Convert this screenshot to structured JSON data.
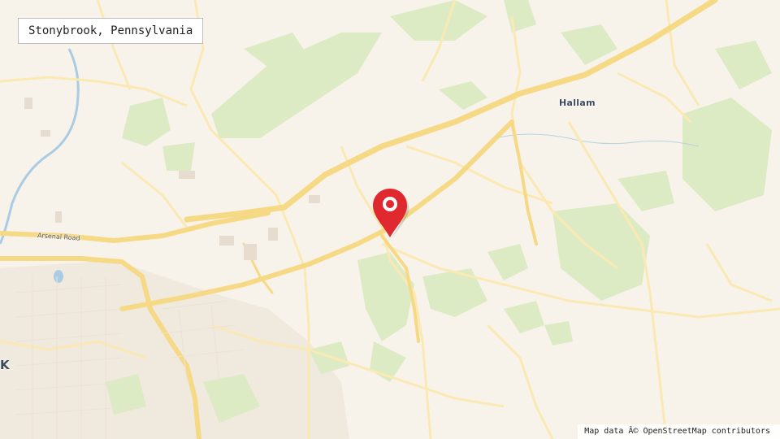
{
  "location": {
    "title": "Stonybrook, Pennsylvania"
  },
  "labels": {
    "hallam": "Hallam",
    "arsenal_road": "Arsenal Road",
    "city_partial": "K"
  },
  "attribution": "Map data Â© OpenStreetMap contributors",
  "colors": {
    "background": "#f7f3ea",
    "major_road": "#f6d985",
    "minor_road": "#fbe9b4",
    "green_area": "#dcebc4",
    "water": "#a9cbe3",
    "marker": "#e0292f"
  },
  "icons": {
    "marker": "map-pin-icon"
  }
}
